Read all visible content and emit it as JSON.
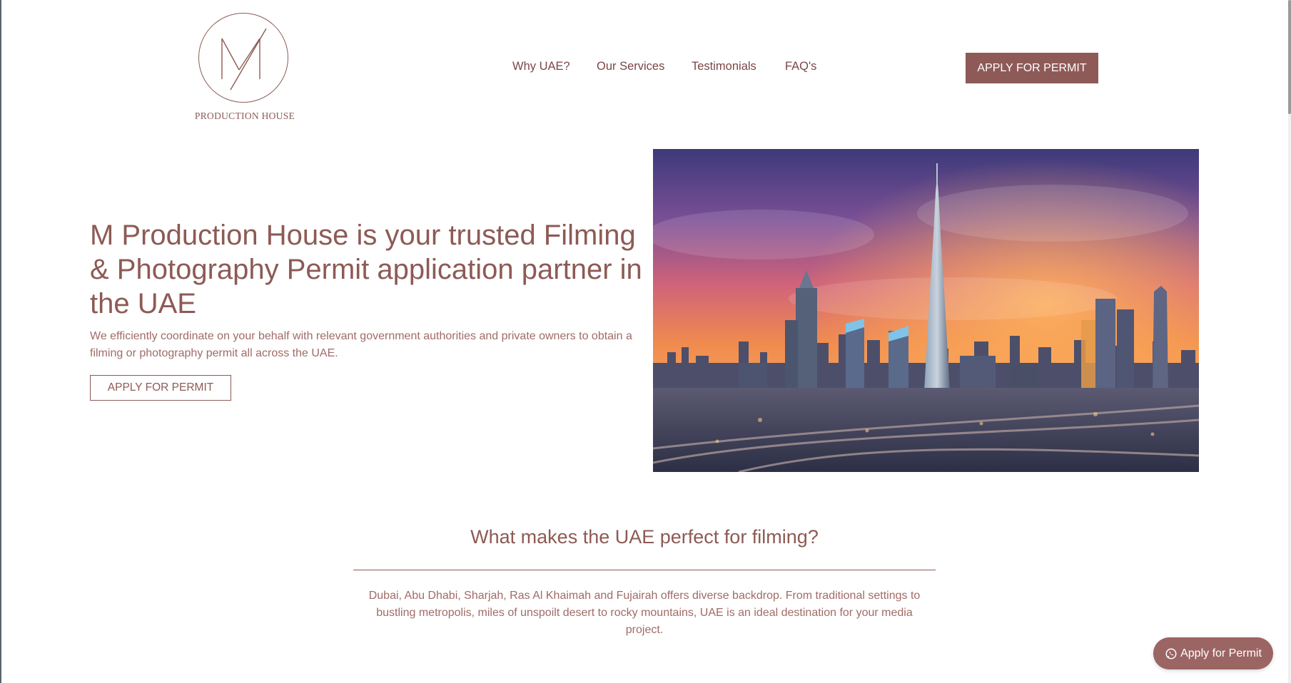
{
  "brand": {
    "logo_text": "PRODUCTION HOUSE",
    "accent": "#8e5a57"
  },
  "nav": {
    "items": [
      {
        "label": "Why UAE?"
      },
      {
        "label": "Our Services"
      },
      {
        "label": "Testimonials"
      },
      {
        "label": "FAQ's"
      }
    ]
  },
  "header": {
    "cta_label": "APPLY FOR PERMIT"
  },
  "hero": {
    "title": "M Production House is your trusted Filming & Photography Permit application partner in the UAE",
    "subtitle": "We efficiently coordinate on your behalf with relevant government authorities and private owners to obtain a filming or photography permit all across the UAE.",
    "cta_label": "APPLY FOR PERMIT",
    "image_icon": "dubai-skyline-image"
  },
  "section": {
    "title": "What makes the UAE perfect for filming?",
    "body": "Dubai, Abu Dhabi, Sharjah, Ras Al Khaimah and Fujairah offers diverse backdrop. From traditional settings to bustling metropolis, miles of unspoilt desert to rocky mountains, UAE is an ideal destination for your media project."
  },
  "floating": {
    "label": "Apply for Permit",
    "icon": "whatsapp-icon"
  }
}
